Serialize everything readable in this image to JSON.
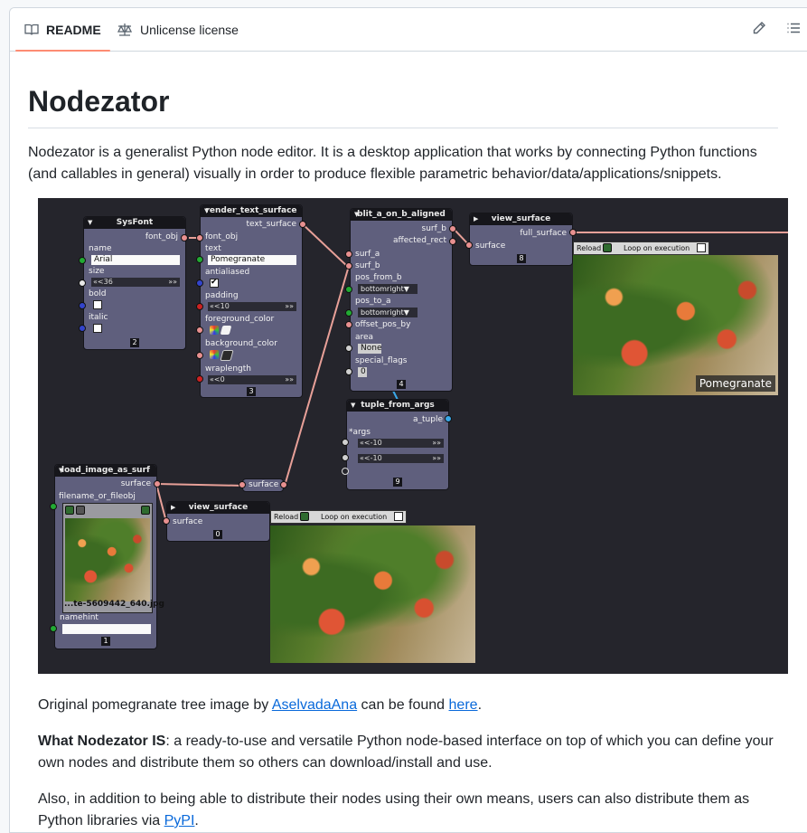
{
  "tabs": {
    "readme": "README",
    "license": "Unlicense license"
  },
  "heading": "Nodezator",
  "intro": "Nodezator is a generalist Python node editor. It is a desktop application that works by connecting Python functions (and callables in general) visually in order to produce flexible parametric behavior/data/applications/snippets.",
  "caption": {
    "before": "Original pomegranate tree image by ",
    "author": "AselvadaAna",
    "middle": " can be found ",
    "link": "here",
    "after": "."
  },
  "what_is": {
    "label": "What Nodezator IS",
    "text": ": a ready-to-use and versatile Python node-based interface on top of which you can define your own nodes and distribute them so others can download/install and use."
  },
  "also": {
    "text": "Also, in addition to being able to distribute their nodes using their own means, users can also distribute them as Python libraries via ",
    "link": "PyPI",
    "after": "."
  },
  "editor": {
    "sysfont": {
      "title": "SysFont",
      "out": "font_obj",
      "name_label": "name",
      "name_value": "Arial",
      "size_label": "size",
      "size_value": "«<36",
      "bold_label": "bold",
      "italic_label": "italic",
      "index": "2"
    },
    "render": {
      "title": "render_text_surface",
      "out": "text_surface",
      "font_label": "font_obj",
      "text_label": "text",
      "text_value": "Pomegranate",
      "antialiased_label": "antialiased",
      "padding_label": "padding",
      "padding_value": "«<10",
      "fg_label": "foreground_color",
      "bg_label": "background_color",
      "wrap_label": "wraplength",
      "wrap_value": "«<0",
      "index": "3"
    },
    "blit": {
      "title": "blit_a_on_b_aligned",
      "out1": "surf_b",
      "out2": "affected_rect",
      "surf_a": "surf_a",
      "surf_b": "surf_b",
      "pos_from_b": "pos_from_b",
      "pos_from_b_value": "bottomright",
      "pos_to_a": "pos_to_a",
      "pos_to_a_value": "bottomright",
      "offset": "offset_pos_by",
      "area": "area",
      "area_value": "None",
      "special": "special_flags",
      "special_value": "0",
      "index": "4"
    },
    "view8": {
      "title": "view_surface",
      "out": "full_surface",
      "in": "surface",
      "index": "8",
      "reload": "Reload",
      "loop": "Loop on execution",
      "caption": "Pomegranate"
    },
    "tuple": {
      "title": "tuple_from_args",
      "out": "a_tuple",
      "args": "*args",
      "v1": "«<-10",
      "v2": "«<-10",
      "index": "9"
    },
    "load": {
      "title": "load_image_as_surf",
      "out": "surface",
      "file_label": "filename_or_fileobj",
      "file_value": "...te-5609442_640.jpg",
      "namehint": "namehint",
      "index": "1"
    },
    "reroute": "surface",
    "view0": {
      "title": "view_surface",
      "in": "surface",
      "index": "0",
      "reload": "Reload",
      "loop": "Loop on execution"
    }
  }
}
